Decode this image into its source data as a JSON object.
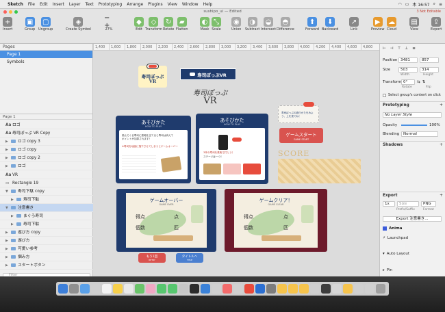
{
  "menubar": {
    "app_name": "Sketch",
    "items": [
      "File",
      "Edit",
      "Insert",
      "Layer",
      "Text",
      "Prototyping",
      "Arrange",
      "Plugins",
      "View",
      "Window",
      "Help"
    ],
    "clock": "木 16:57"
  },
  "window": {
    "title": "sushipo_ui — Edited",
    "warning": "3 Not Editable"
  },
  "toolbar": {
    "insert": "Insert",
    "group": "Group",
    "ungroup": "Ungroup",
    "create_symbol": "Create Symbol",
    "zoom": "27%",
    "edit": "Edit",
    "transform": "Transform",
    "rotate": "Rotate",
    "flatten": "Flatten",
    "mask": "Mask",
    "scale": "Scale",
    "union": "Union",
    "subtract": "Subtract",
    "intersect": "Intersect",
    "difference": "Difference",
    "forward": "Forward",
    "backward": "Backward",
    "link": "Link",
    "preview": "Preview",
    "cloud": "Cloud",
    "view": "View",
    "export": "Export"
  },
  "ruler": [
    "1,400",
    "1,600",
    "1,800",
    "2,000",
    "2,200",
    "2,400",
    "2,600",
    "2,800",
    "3,000",
    "3,200",
    "3,400",
    "3,600",
    "3,800",
    "4,000",
    "4,200",
    "4,400",
    "4,600",
    "4,800"
  ],
  "pages": {
    "header": "Pages",
    "items": [
      "Page 1",
      "Symbols"
    ],
    "selected": "Page 1"
  },
  "layers": {
    "header": "Page 1",
    "items": [
      {
        "kind": "text",
        "label": "Aa",
        "name": "ロゴ"
      },
      {
        "kind": "text",
        "label": "Aa",
        "name": "寿司ぽっぷ VR Copy"
      },
      {
        "kind": "group",
        "label": "",
        "name": "ロゴ copy 3"
      },
      {
        "kind": "group",
        "label": "",
        "name": "ロゴ copy"
      },
      {
        "kind": "group",
        "label": "",
        "name": "ロゴ copy 2"
      },
      {
        "kind": "group",
        "label": "",
        "name": "ロゴ"
      },
      {
        "kind": "text",
        "label": "Aa",
        "name": "VR"
      },
      {
        "kind": "rect",
        "label": "",
        "name": "Rectangle 19"
      },
      {
        "kind": "group",
        "label": "",
        "name": "寿司下駄 copy"
      },
      {
        "kind": "group",
        "label": "",
        "name": "寿司下駄"
      },
      {
        "kind": "group",
        "label": "",
        "name": "注意書き"
      },
      {
        "kind": "group",
        "label": "",
        "name": "まぐろ寿司"
      },
      {
        "kind": "group",
        "label": "",
        "name": "寿司下駄"
      },
      {
        "kind": "group",
        "label": "",
        "name": "遊び方 copy"
      },
      {
        "kind": "group",
        "label": "",
        "name": "遊び方"
      },
      {
        "kind": "group",
        "label": "",
        "name": "可愛い参考"
      },
      {
        "kind": "group",
        "label": "",
        "name": "掴み方"
      },
      {
        "kind": "group",
        "label": "",
        "name": "スタートボタン"
      }
    ],
    "filter_placeholder": "Filter"
  },
  "inspector": {
    "position_label": "Position",
    "pos_x": "3481",
    "pos_y": "857",
    "size_label": "Size",
    "width": "503",
    "height": "314",
    "width_label": "Width",
    "height_label": "Height",
    "transform_label": "Transform",
    "rotate_value": "0°",
    "rotate_label": "Rotate",
    "flip_label": "Flip",
    "clip_label": "Select group's content on click",
    "prototyping": "Prototyping",
    "no_layer_style": "No Layer Style",
    "opacity_label": "Opacity",
    "opacity_value": "100%",
    "blending_label": "Blending",
    "blending_value": "Normal",
    "shadows": "Shadows",
    "export": "Export",
    "export_scale": "1x",
    "export_suffix": "Size",
    "export_format": "PNG",
    "export_prefix_label": "Prefix/Suffix",
    "export_format_label": "Format",
    "export_button": "Export 注意書き...",
    "plugin_anima": "Anima",
    "plugin_launchpad": "Launchpad",
    "auto_layout": "Auto Layout",
    "pin": "Pin"
  },
  "canvas": {
    "logo_title": "寿司ぽっぷ",
    "logo_vr": "VR",
    "banner_title": "寿司ぽっぷVR",
    "main_title": "寿司ぽっぷ",
    "main_vr": "VR",
    "howto1_title": "あそびかた",
    "howto1_sub": "HOW TO PLAY",
    "howto1_line1": "飛んでくる寿司に鉄砲を当てると寿司は消えて",
    "howto1_line2": "ポイントが加算されます！",
    "howto1_line3": "※寿司を地面に落下させてしまうとゲームオーバー",
    "howto2_title": "あそびかた",
    "howto2_sub": "HOW TO PLAY",
    "howto2_line1": "3本の寿司を鉄砲で打とう！",
    "howto2_line2": "ステージは一つ！",
    "tip_text": "寿司ぽっぷの遊びかたをみよう、上を見てね！",
    "start_btn": "ゲームスタート",
    "start_sub": "GAME START",
    "score_label": "SCORE",
    "gameover_title": "ゲームオーバー",
    "gameover_sub": "GAME OVER",
    "clear_title": "ゲームクリア！",
    "clear_sub": "GAME CLEAR",
    "points_label": "得点",
    "points_unit": "点",
    "count_label": "個数",
    "count_unit": "匹",
    "retry_btn": "もう1回",
    "retry_sub": "RETRY",
    "title_btn": "タイトルへ",
    "title_sub": "TITLE"
  },
  "colors": {
    "navy": "#1f3b6d",
    "maroon": "#6d1a2b",
    "red_button": "#d9534f",
    "blue_button": "#4a7fd0",
    "selection": "#4a90e2"
  }
}
